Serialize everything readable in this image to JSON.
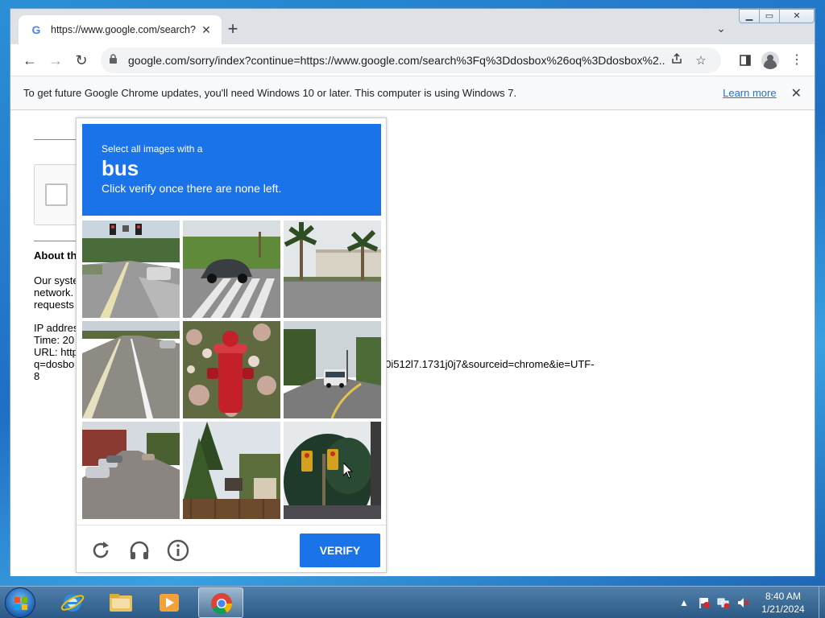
{
  "browser": {
    "tab": {
      "title": "https://www.google.com/search?"
    },
    "address_bar": {
      "url": "google.com/sorry/index?continue=https://www.google.com/search%3Fq%3Ddosbox%26oq%3Ddosbox%2..."
    },
    "infobar": {
      "message": "To get future Google Chrome updates, you'll need Windows 10 or later. This computer is using Windows 7.",
      "link": "Learn more"
    }
  },
  "page": {
    "about": "About th",
    "para_lines": [
      "Our syste",
      "network.",
      "requests"
    ],
    "ip_lines": [
      "IP addres",
      "Time: 20",
      "URL: http",
      "q=dosbo",
      "8"
    ],
    "url_tail": "0j0i512l7.1731j0j7&sourceid=chrome&ie=UTF-"
  },
  "captcha": {
    "header": {
      "line1": "Select all images with a",
      "target": "bus",
      "line3": "Click verify once there are none left."
    },
    "tiles": [
      {
        "name": "street-traffic-lights-tile"
      },
      {
        "name": "car-crosswalk-tile"
      },
      {
        "name": "palm-trees-building-tile"
      },
      {
        "name": "road-lanes-tile"
      },
      {
        "name": "fire-hydrant-tile"
      },
      {
        "name": "road-with-bus-tile"
      },
      {
        "name": "parked-cars-street-tile"
      },
      {
        "name": "trees-house-tile"
      },
      {
        "name": "traffic-light-tree-tile"
      }
    ],
    "verify_label": "VERIFY"
  },
  "taskbar": {
    "time": "8:40 AM",
    "date": "1/21/2024"
  },
  "colors": {
    "captcha_blue": "#1a73e8",
    "chrome_tabstrip": "#dee1e6"
  }
}
